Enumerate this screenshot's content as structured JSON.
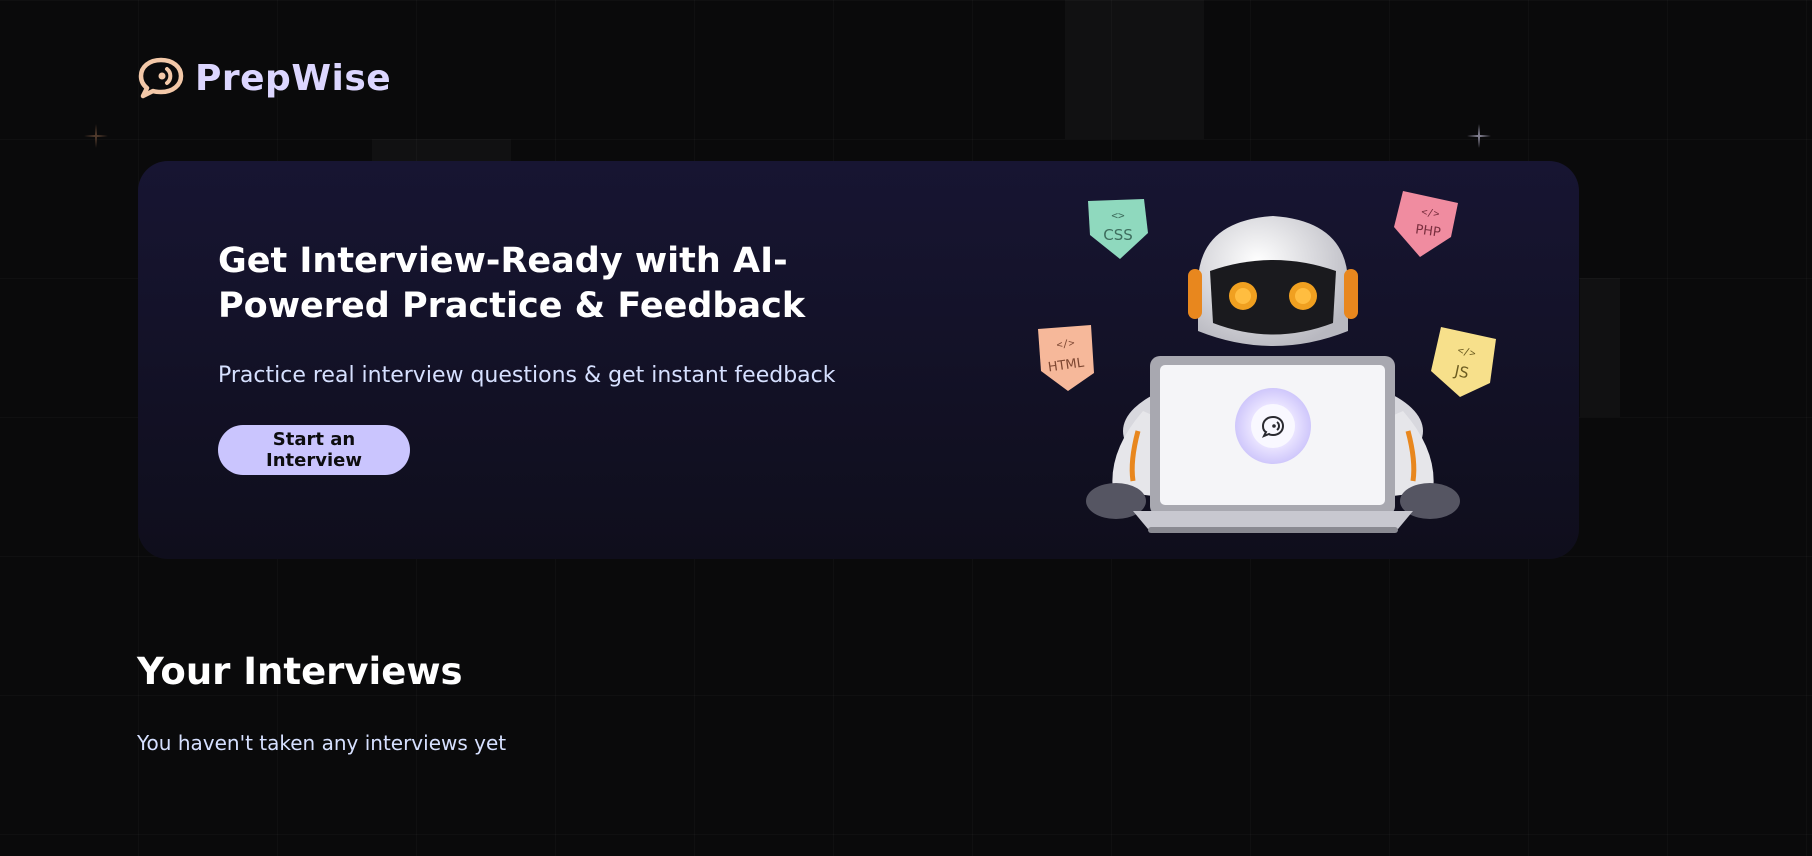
{
  "brand": {
    "name": "PrepWise",
    "logo_icon": "chat-bubble-logo-icon"
  },
  "hero": {
    "title": "Get Interview-Ready with AI-Powered Practice & Feedback",
    "subtitle": "Practice real interview questions & get instant feedback",
    "cta_label": "Start an Interview",
    "illustration": "robot-with-laptop",
    "tech_badges": [
      "CSS",
      "PHP",
      "HTML",
      "JS"
    ]
  },
  "interviews": {
    "title": "Your Interviews",
    "empty_message": "You haven't taken any interviews yet"
  },
  "colors": {
    "background": "#0a0a0b",
    "brand_text": "#dcd6ff",
    "cta_background": "#cac5fe",
    "hero_gradient_top": "#171532",
    "hero_gradient_bottom": "#0f0e1c",
    "subtitle_text": "#d6e0ff"
  }
}
